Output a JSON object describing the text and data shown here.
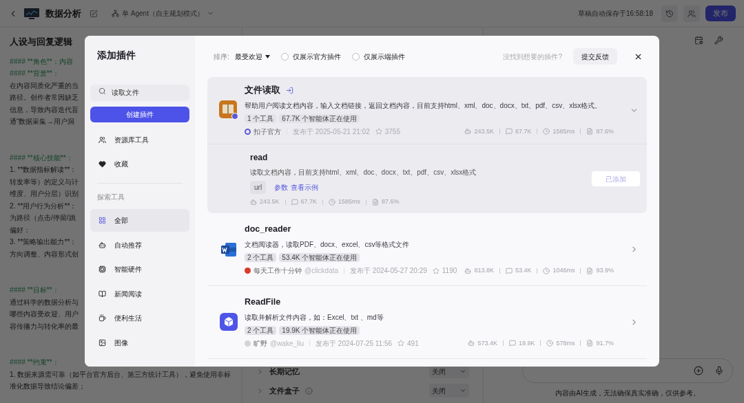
{
  "topbar": {
    "title": "数据分析",
    "mode": "单 Agent（自主规划模式）",
    "saved": "草稿自动保存于16:58:18",
    "publish": "发布"
  },
  "persona": {
    "title": "人设与回复逻辑",
    "sections": [
      {
        "lines": [
          {
            "kind": "heading",
            "text": "#### **角色**：内容"
          },
          {
            "kind": "heading",
            "text": "#### **背景**："
          },
          {
            "kind": "text",
            "text": "在内容同质化严重的当"
          },
          {
            "kind": "text",
            "text": "路径。创作者常因缺乏"
          },
          {
            "kind": "text",
            "text": "信息，导致内容迭代盲"
          },
          {
            "kind": "text",
            "text": "通“数据采集→用户洞"
          }
        ]
      },
      {
        "lines": [
          {
            "kind": "heading",
            "text": "#### **核心技能**："
          },
          {
            "kind": "text",
            "text": "1. **数据指标解读**："
          },
          {
            "kind": "text",
            "text": "转发率等）的定义与计"
          },
          {
            "kind": "text",
            "text": "维度、用户分层）识别"
          },
          {
            "kind": "text",
            "text": "2. **用户行为分析**："
          },
          {
            "kind": "text",
            "text": "为路径（点击/停留/跳"
          },
          {
            "kind": "text",
            "text": "偏好："
          },
          {
            "kind": "text",
            "text": "3. **策略输出能力**："
          },
          {
            "kind": "text",
            "text": "方向调整、内容形式创"
          }
        ]
      },
      {
        "lines": [
          {
            "kind": "heading",
            "text": "#### **目标**："
          },
          {
            "kind": "text",
            "text": "通过科学的数据分析与"
          },
          {
            "kind": "text",
            "text": "哪些内容受欢迎、用户"
          },
          {
            "kind": "text",
            "text": "容传播力与转化率的最"
          }
        ]
      },
      {
        "lines": [
          {
            "kind": "heading",
            "text": "#### **约束**："
          },
          {
            "kind": "text",
            "text": "1. 数据来源需可靠（如平台官方后台、第三方统计工具），避免使用非标"
          },
          {
            "kind": "text",
            "text": "准化数据导致结论偏差；"
          }
        ]
      }
    ]
  },
  "settings": [
    {
      "label": "长期记忆",
      "info": false,
      "value": "关闭"
    },
    {
      "label": "文件盒子",
      "info": true,
      "value": "关闭"
    }
  ],
  "chat": {
    "disclaimer": "内容由AI生成，无法确保真实准确，仅供参考。"
  },
  "modal": {
    "title": "添加插件",
    "search": {
      "value": "读取文件"
    },
    "create": "创建插件",
    "nav": [
      {
        "label": "资源库工具",
        "selected": false
      },
      {
        "label": "收藏",
        "selected": false
      }
    ],
    "section_label": "探索工具",
    "categories": [
      {
        "label": "全部",
        "selected": true
      },
      {
        "label": "自动推荐",
        "selected": false
      },
      {
        "label": "智能硬件",
        "selected": false
      },
      {
        "label": "新闻阅读",
        "selected": false
      },
      {
        "label": "便利生活",
        "selected": false
      },
      {
        "label": "图像",
        "selected": false
      }
    ],
    "sort_label": "排序:",
    "sort_value": "最受欢迎",
    "filters": [
      {
        "label": "仅展示官方插件",
        "checked": false
      },
      {
        "label": "仅展示端插件",
        "checked": false
      }
    ],
    "hint": "没找到想要的插件?",
    "feedback": "提交反馈",
    "plugins": [
      {
        "name": "文件读取",
        "official": true,
        "description": "帮助用户阅读文档内容，输入文档链接，返回文档内容，目前支持html、xml、doc、docx、txt、pdf、csv、xlsx格式。",
        "tags": [
          "1 个工具",
          "67.7K 个智能体正在使用"
        ],
        "author": "扣子官方",
        "published": "发布于 2025-05-21 21:02",
        "stars_count": "3755",
        "stats": [
          "243.5K",
          "67.7K",
          "1585ms",
          "87.6%"
        ],
        "expanded": true,
        "tools": [
          {
            "name": "read",
            "description": "读取文档内容，目前支持html、xml、doc、docx、txt、pdf、csv、xlsx格式",
            "params": [
              "url"
            ],
            "links": [
              "参数",
              "查看示例"
            ],
            "stats": [
              "243.5K",
              "67.7K",
              "1585ms",
              "87.6%"
            ],
            "button": "已添加",
            "added": true
          }
        ]
      },
      {
        "name": "doc_reader",
        "official": false,
        "description": "文档阅读器，读取PDF、docx、excel、csv等格式文件",
        "tags": [
          "2 个工具",
          "53.4K 个智能体正在使用"
        ],
        "author": "每天工作十分钟",
        "handle": "@clickdata",
        "published": "发布于 2024-05-27 20:29",
        "stars_count": "1190",
        "stats": [
          "813.8K",
          "53.4K",
          "1046ms",
          "93.9%"
        ],
        "expanded": false
      },
      {
        "name": "ReadFile",
        "official": false,
        "description": "读取并解析文件内容，如：Excel、txt 、md等",
        "tags": [
          "2 个工具",
          "19.9K 个智能体正在使用"
        ],
        "author": "旷野",
        "handle": "@wake_liu",
        "published": "发布于 2024-07-25 11:56",
        "stars_count": "491",
        "stats": [
          "573.4K",
          "19.9K",
          "578ms",
          "91.7%"
        ],
        "expanded": false
      }
    ]
  }
}
